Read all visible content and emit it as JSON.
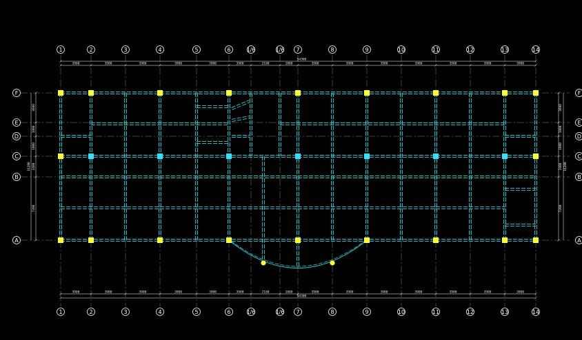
{
  "plan": {
    "columns": [
      "1",
      "2",
      "3",
      "4",
      "5",
      "6",
      "1/6",
      "1/6",
      "7",
      "8",
      "9",
      "10",
      "11",
      "12",
      "13",
      "14"
    ],
    "rows": [
      "A",
      "B",
      "C",
      "D",
      "E",
      "F"
    ],
    "dims_top": [
      "3900",
      "3900",
      "3900",
      "3900",
      "3900",
      "3900",
      "2100",
      "1800",
      "3900",
      "3900",
      "3900",
      "3900",
      "3900",
      "3900",
      "3900"
    ],
    "dims_bottom": [
      "3900",
      "3900",
      "3900",
      "3900",
      "3900",
      "3900",
      "2100",
      "1800",
      "3900",
      "3900",
      "3900",
      "3900",
      "3900",
      "3900",
      "3900"
    ],
    "total_top": "54300",
    "total_bottom": "54300",
    "dims_left": [
      "3600",
      "1800",
      "1800",
      "2400",
      "7200"
    ],
    "dims_right": [
      "3600",
      "1800",
      "1800",
      "2400",
      "7200"
    ],
    "total_left": "16200",
    "total_right": "16200"
  }
}
